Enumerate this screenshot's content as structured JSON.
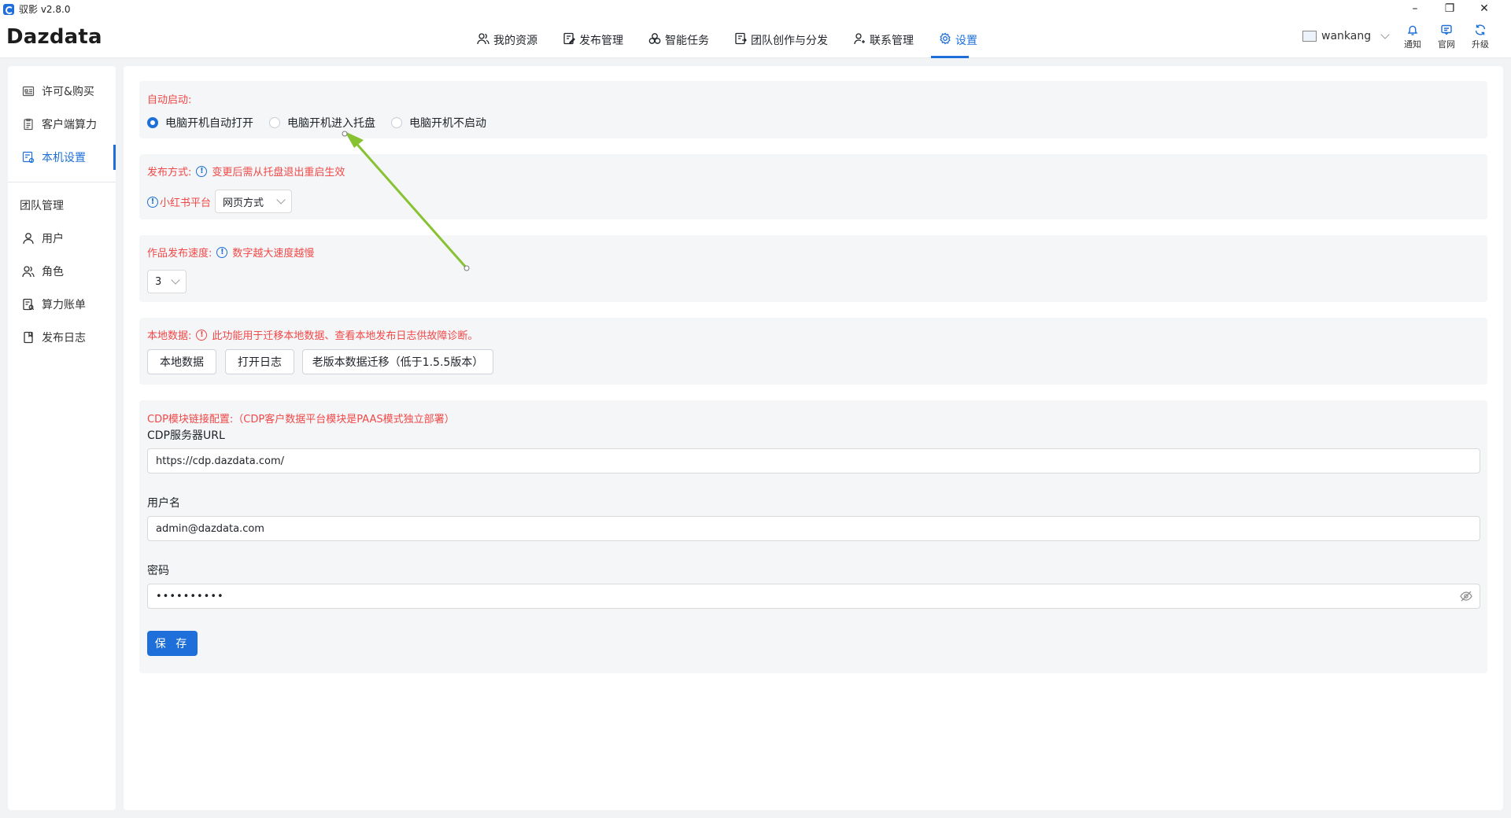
{
  "window": {
    "app_title": "驭影 v2.8.0",
    "brand": "Dazdata",
    "controls": {
      "minimize": "–",
      "restore": "❐",
      "close": "✕"
    }
  },
  "topnav": [
    {
      "label": "我的资源",
      "icon": "users-icon"
    },
    {
      "label": "发布管理",
      "icon": "edit-doc-icon"
    },
    {
      "label": "智能任务",
      "icon": "cluster-icon"
    },
    {
      "label": "团队创作与分发",
      "icon": "share-doc-icon"
    },
    {
      "label": "联系管理",
      "icon": "contact-icon"
    },
    {
      "label": "设置",
      "icon": "gear-icon",
      "active": true
    }
  ],
  "user": {
    "name": "wankang"
  },
  "top_actions": [
    {
      "label": "通知",
      "icon": "bell-icon"
    },
    {
      "label": "官网",
      "icon": "chat-icon"
    },
    {
      "label": "升级",
      "icon": "refresh-icon"
    }
  ],
  "sidebar": {
    "items": [
      {
        "label": "许可&购买",
        "icon": "license-icon"
      },
      {
        "label": "客户端算力",
        "icon": "clipboard-icon"
      },
      {
        "label": "本机设置",
        "icon": "device-settings-icon",
        "active": true
      }
    ],
    "group_title": "团队管理",
    "group_items": [
      {
        "label": "用户",
        "icon": "user-icon"
      },
      {
        "label": "角色",
        "icon": "role-icon"
      },
      {
        "label": "算力账单",
        "icon": "bill-icon"
      },
      {
        "label": "发布日志",
        "icon": "log-icon"
      }
    ]
  },
  "autostart": {
    "label": "自动启动:",
    "options": [
      "电脑开机自动打开",
      "电脑开机进入托盘",
      "电脑开机不启动"
    ],
    "selected": "电脑开机自动打开"
  },
  "publish_mode": {
    "label": "发布方式:",
    "hint": "变更后需从托盘退出重启生效",
    "platform_label": "小红书平台",
    "platform_value": "网页方式"
  },
  "publish_speed": {
    "label": "作品发布速度:",
    "hint": "数字越大速度越慢",
    "value": "3"
  },
  "local_data": {
    "label": "本地数据:",
    "hint": "此功能用于迁移本地数据、查看本地发布日志供故障诊断。",
    "buttons": [
      "本地数据",
      "打开日志",
      "老版本数据迁移（低于1.5.5版本）"
    ]
  },
  "cdp": {
    "label": "CDP模块链接配置:（CDP客户数据平台模块是PAAS模式独立部署）",
    "url_label": "CDP服务器URL",
    "url_value": "https://cdp.dazdata.com/",
    "username_label": "用户名",
    "username_value": "admin@dazdata.com",
    "password_label": "密码",
    "password_value": "••••••••••",
    "save_label": "保 存"
  },
  "colors": {
    "accent": "#1e6fd9",
    "warning_text": "#f04848",
    "annotation_arrow": "#86c232"
  }
}
